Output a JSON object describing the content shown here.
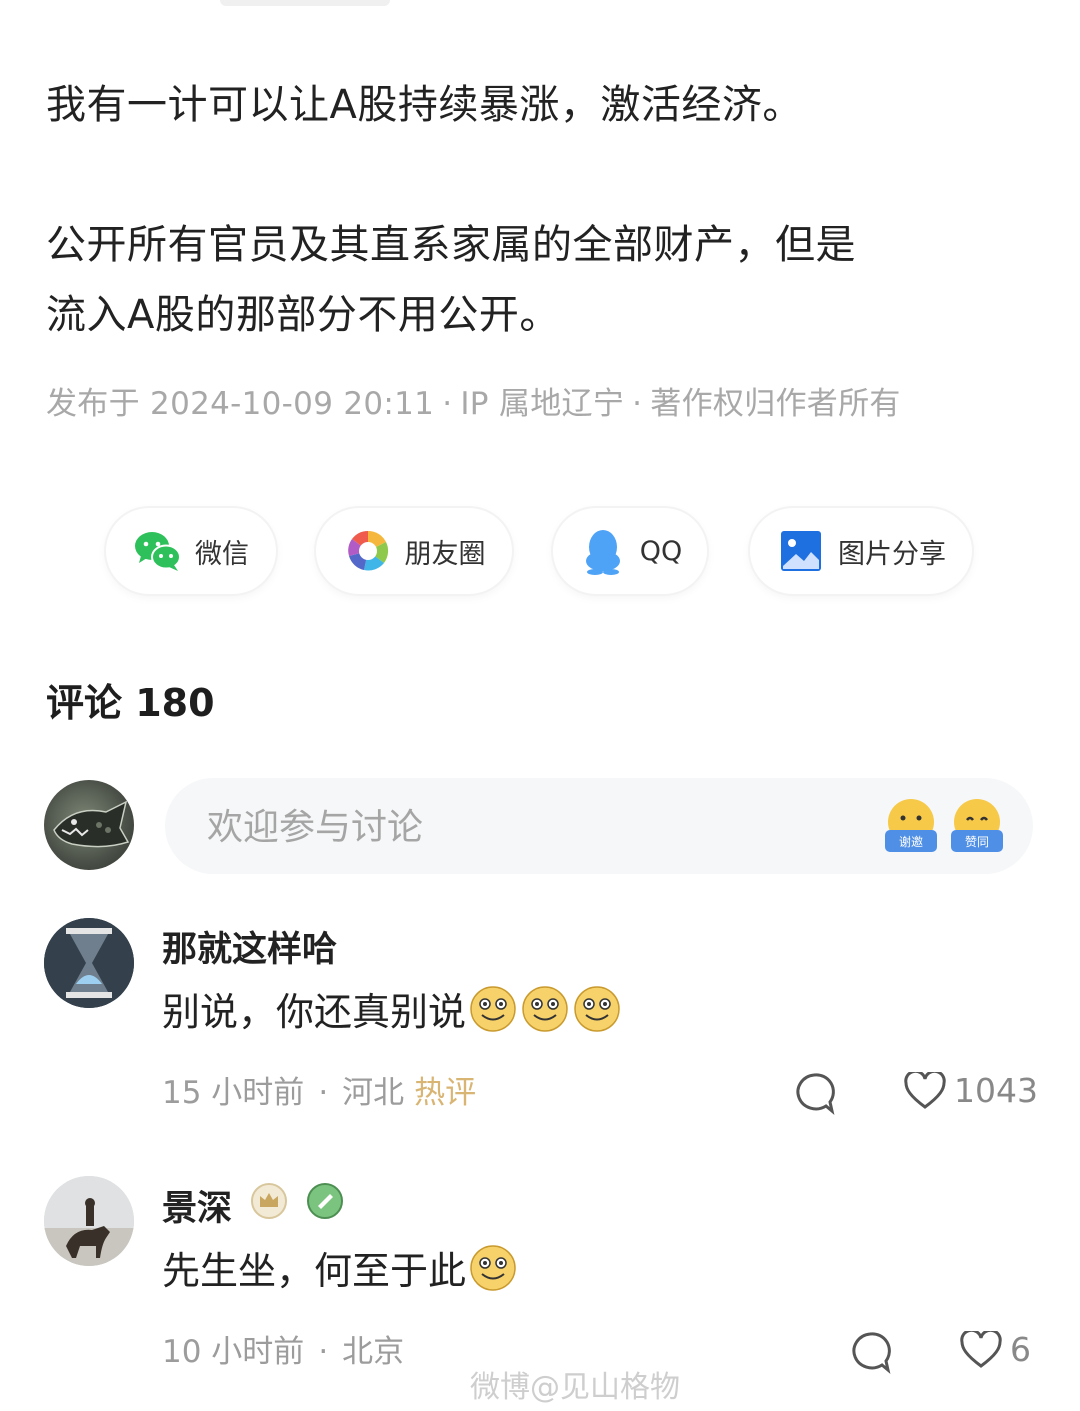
{
  "post": {
    "para1": "我有一计可以让A股持续暴涨，激活经济。",
    "para2_line1": "公开所有官员及其直系家属的全部财产，但是",
    "para2_line2": "流入A股的那部分不用公开。",
    "published": "发布于 2024-10-09 20:11",
    "ip": "IP 属地辽宁",
    "copyright": "著作权归作者所有",
    "sep": "·"
  },
  "share": {
    "wechat": "微信",
    "moments": "朋友圈",
    "qq": "QQ",
    "image": "图片分享"
  },
  "comments_section": {
    "title": "评论 180",
    "input_placeholder": "欢迎参与讨论",
    "emoji_labels": [
      "谢邀",
      "赞同"
    ]
  },
  "comments": [
    {
      "author": "那就这样哈",
      "text": "别说，你还真别说",
      "time": "15 小时前",
      "location": "河北",
      "tag": "热评",
      "likes": "1043",
      "emoji_count": 3
    },
    {
      "author": "景深",
      "text": "先生坐，何至于此",
      "time": "10 小时前",
      "location": "北京",
      "likes": "6",
      "emoji_count": 1
    }
  ],
  "watermark": "微博@见山格物",
  "colors": {
    "text": "#222222",
    "meta": "#a8a8a8",
    "hot_tag": "#d9b574",
    "wechat_green": "#2ec05a",
    "qq_blue": "#4fa3f7",
    "image_blue": "#1e6fe0"
  }
}
